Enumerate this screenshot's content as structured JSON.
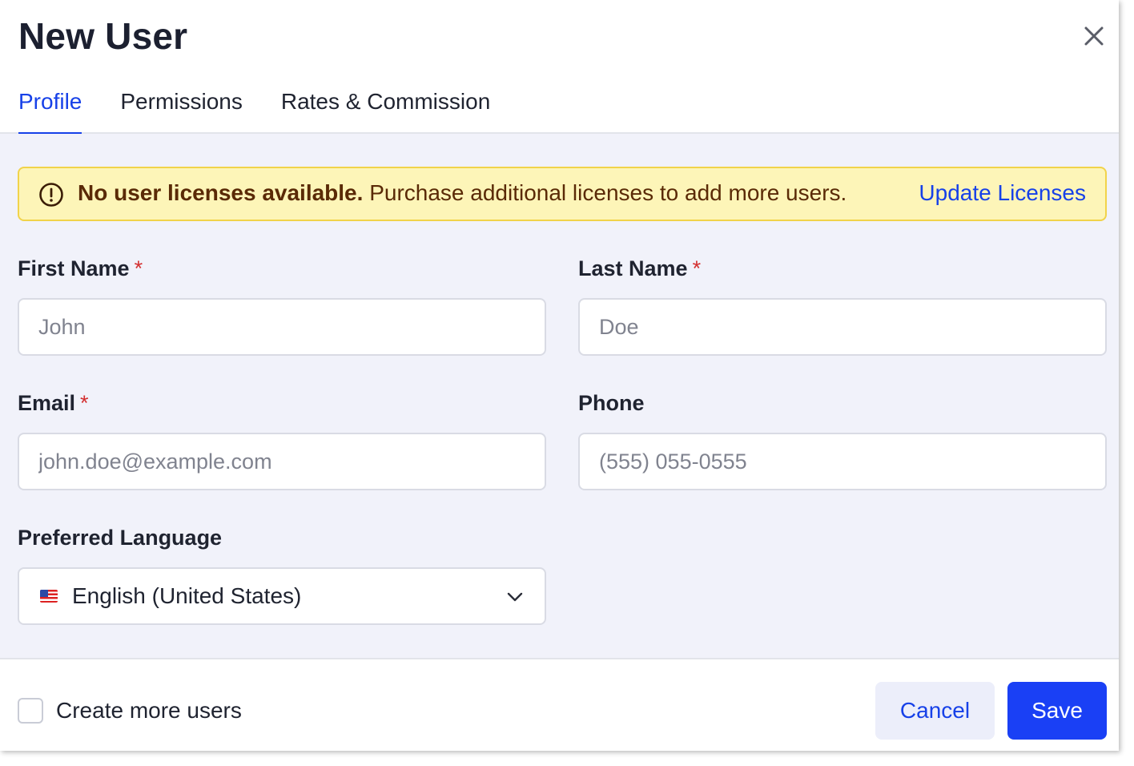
{
  "dialog": {
    "title": "New User",
    "close_icon": "close-icon"
  },
  "tabs": [
    {
      "label": "Profile",
      "active": true
    },
    {
      "label": "Permissions",
      "active": false
    },
    {
      "label": "Rates & Commission",
      "active": false
    }
  ],
  "banner": {
    "icon": "alert-circle-icon",
    "bold": "No user licenses available.",
    "text": " Purchase additional licenses to add more users.",
    "link": "Update Licenses",
    "background": "#fdf5b8",
    "border": "#f1d34a"
  },
  "form": {
    "first_name": {
      "label": "First Name",
      "required_mark": "*",
      "value": "",
      "placeholder": "John"
    },
    "last_name": {
      "label": "Last Name",
      "required_mark": "*",
      "value": "",
      "placeholder": "Doe"
    },
    "email": {
      "label": "Email",
      "required_mark": "*",
      "value": "",
      "placeholder": "john.doe@example.com"
    },
    "phone": {
      "label": "Phone",
      "value": "",
      "placeholder": "(555) 055-0555"
    },
    "language": {
      "label": "Preferred Language",
      "selected": "English (United States)",
      "flag_icon": "us-flag-icon",
      "chevron_icon": "chevron-down-icon"
    }
  },
  "footer": {
    "checkbox_label": "Create more users",
    "checked": false,
    "cancel_label": "Cancel",
    "save_label": "Save"
  },
  "colors": {
    "accent": "#1741e8",
    "primary_button": "#1a40f5",
    "required": "#d32f2f",
    "content_bg": "#f1f2fa"
  }
}
